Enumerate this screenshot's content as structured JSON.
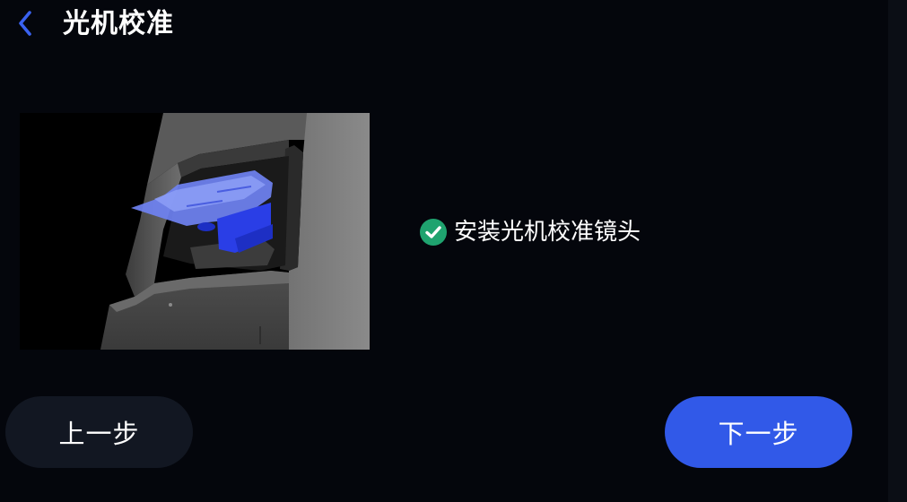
{
  "header": {
    "title": "光机校准",
    "back_icon": "chevron-left-icon"
  },
  "illustration": {
    "subject": "printer-optical-engine-calibration-lens"
  },
  "steps": [
    {
      "label": "安装光机校准镜头",
      "status": "completed",
      "icon": "check-circle-icon"
    }
  ],
  "buttons": {
    "prev_label": "上一步",
    "next_label": "下一步"
  },
  "colors": {
    "background": "#04060c",
    "accent": "#3159e8",
    "success": "#1fa36f",
    "secondary_button": "#121722"
  }
}
